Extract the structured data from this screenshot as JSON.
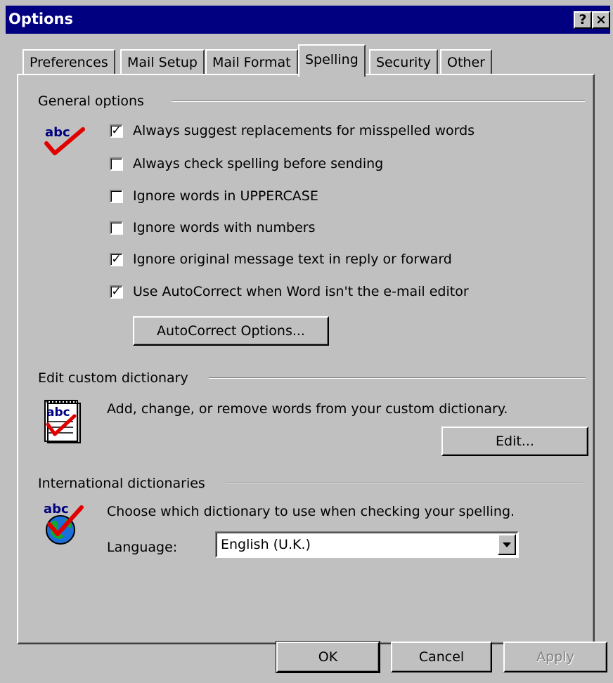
{
  "window": {
    "title": "Options",
    "help_btn": "?",
    "close_btn": "×"
  },
  "tabs": [
    {
      "label": "Preferences"
    },
    {
      "label": "Mail Setup"
    },
    {
      "label": "Mail Format"
    },
    {
      "label": "Spelling",
      "active": true
    },
    {
      "label": "Security"
    },
    {
      "label": "Other"
    }
  ],
  "general": {
    "heading": "General options",
    "icon": "abc-spellcheck-icon",
    "options": [
      {
        "label": "Always suggest replacements for misspelled words",
        "checked": true
      },
      {
        "label": "Always check spelling before sending",
        "checked": false
      },
      {
        "label": "Ignore words in UPPERCASE",
        "checked": false
      },
      {
        "label": "Ignore words with numbers",
        "checked": false
      },
      {
        "label": "Ignore original message text in reply or forward",
        "checked": true
      },
      {
        "label": "Use AutoCorrect when Word isn't the e-mail editor",
        "checked": true
      }
    ],
    "autocorrect_button": "AutoCorrect Options..."
  },
  "custom_dict": {
    "heading": "Edit custom dictionary",
    "icon": "dictionary-notebook-icon",
    "description": "Add, change, or remove words from your custom dictionary.",
    "edit_button": "Edit..."
  },
  "intl_dict": {
    "heading": "International dictionaries",
    "icon": "globe-spellcheck-icon",
    "description": "Choose which dictionary to use when checking your spelling.",
    "language_label": "Language:",
    "language_value": "English (U.K.)"
  },
  "footer": {
    "ok": "OK",
    "cancel": "Cancel",
    "apply": "Apply"
  },
  "colors": {
    "title_bar": "#000080",
    "face": "#c0c0c0",
    "check_red": "#e00000",
    "abc_blue": "#000080"
  }
}
